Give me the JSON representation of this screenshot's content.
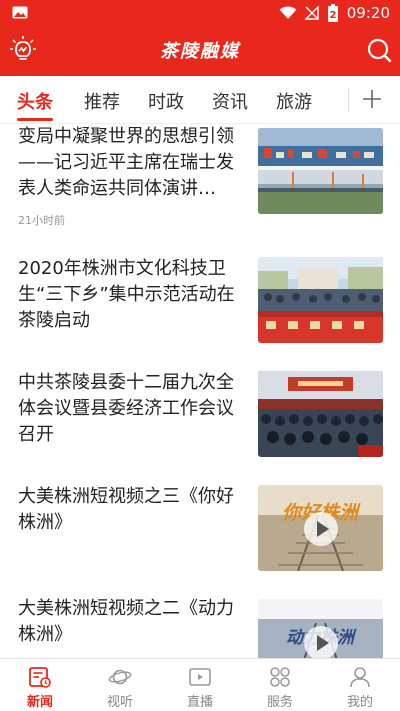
{
  "status_bar": {
    "time": "09:20",
    "battery": "2"
  },
  "header": {
    "brand": "茶陵融媒"
  },
  "tabs": [
    {
      "label": "头条"
    },
    {
      "label": "推荐"
    },
    {
      "label": "时政"
    },
    {
      "label": "资讯"
    },
    {
      "label": "旅游"
    }
  ],
  "feed": [
    {
      "title": "变局中凝聚世界的思想引领——记习近平主席在瑞士发表人类命运共同体演讲…",
      "meta": "21小时前"
    },
    {
      "title": "2020年株洲市文化科技卫生“三下乡”集中示范活动在茶陵启动"
    },
    {
      "title": "中共茶陵县委十二届九次全体会议暨县委经济工作会议召开"
    },
    {
      "title": "大美株洲短视频之三《你好株洲》",
      "thumb_text": "你好株洲"
    },
    {
      "title": "大美株洲短视频之二《动力株洲》",
      "thumb_text": "动力株洲"
    }
  ],
  "bottom_nav": [
    {
      "label": "新闻"
    },
    {
      "label": "视听"
    },
    {
      "label": "直播"
    },
    {
      "label": "服务"
    },
    {
      "label": "我的"
    }
  ],
  "colors": {
    "accent": "#e8281c",
    "text": "#222222",
    "muted": "#999999"
  }
}
